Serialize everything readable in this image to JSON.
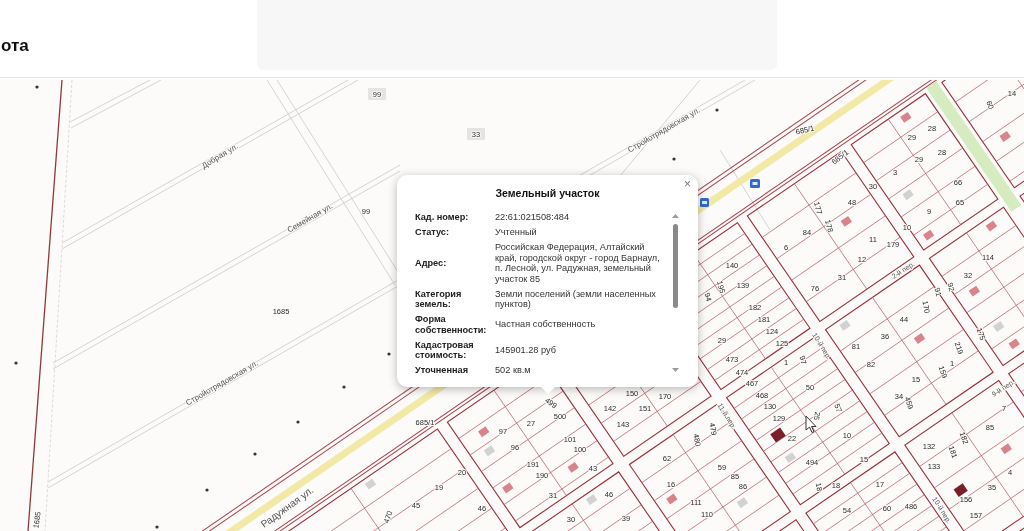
{
  "header": {
    "title": "ота"
  },
  "map": {
    "street_labels": [
      "Добрая ул.",
      "Стройотрядовская ул.",
      "Семейная ул.",
      "2-й пер.",
      "10-й пер.",
      "Стройотрядовская ул.",
      "9-й пер.",
      "11-й пер.",
      "10-й пер.",
      "Радужная ул."
    ],
    "parcel_numbers": [
      "99",
      "14",
      "60",
      "685/1",
      "28",
      "33",
      "29",
      "28",
      "685/1",
      "29",
      "3",
      "66",
      "30",
      "48",
      "65",
      "177",
      "99",
      "9",
      "178",
      "10",
      "84",
      "11",
      "179",
      "6",
      "12",
      "114",
      "140",
      "31",
      "32",
      "195",
      "139",
      "76",
      "92",
      "91",
      "94",
      "182",
      "170",
      "1685",
      "181",
      "44",
      "124",
      "36",
      "175",
      "29",
      "125",
      "81",
      "219",
      "473",
      "1",
      "97",
      "82",
      "1",
      "474",
      "159",
      "15",
      "467",
      "50",
      "150",
      "170",
      "468",
      "34",
      "499",
      "459",
      "142",
      "151",
      "130",
      "57",
      "7",
      "500",
      "129",
      "25",
      "685/1",
      "27",
      "143",
      "85",
      "479",
      "97",
      "10",
      "101",
      "480",
      "22",
      "182",
      "96",
      "132",
      "100",
      "181",
      "62",
      "15",
      "191",
      "494",
      "43",
      "59",
      "133",
      "20",
      "4",
      "190",
      "85",
      "19",
      "16",
      "86",
      "18",
      "18",
      "17",
      "35",
      "31",
      "46",
      "156",
      "111",
      "45",
      "46",
      "54",
      "60",
      "486",
      "1685",
      "470",
      "30",
      "39",
      "110",
      "157"
    ]
  },
  "popup": {
    "title": "Земельный участок",
    "close": "×",
    "rows": [
      {
        "label": "Кад. номер:",
        "value": "22:61:021508:484"
      },
      {
        "label": "Статус:",
        "value": "Учтенный"
      },
      {
        "label": "Адрес:",
        "value": "Российская Федерация, Алтайский край, городской округ - город Барнаул, п. Лесной, ул. Радужная, земельный участок 85"
      },
      {
        "label": "Категория земель:",
        "value": "Земли поселений (земли населенных пунктов)"
      },
      {
        "label": "Форма собственности:",
        "value": "Частная собственность"
      },
      {
        "label": "Кадастровая стоимость:",
        "value": "145901.28 руб"
      },
      {
        "label": "Уточненная",
        "value": "502 кв.м"
      }
    ]
  }
}
